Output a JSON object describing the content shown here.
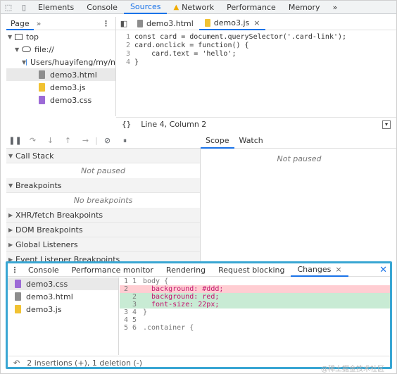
{
  "top_tabs": [
    "Elements",
    "Console",
    "Sources",
    "Network",
    "Performance",
    "Memory"
  ],
  "top_tab_active": "Sources",
  "top_more": "»",
  "navigator": {
    "tab": "Page",
    "chevron": "»",
    "more": "⋮",
    "tree": {
      "top": "top",
      "origin": "file://",
      "folder": "Users/huayifeng/my/n",
      "files": [
        "demo3.html",
        "demo3.js",
        "demo3.css"
      ]
    }
  },
  "editor": {
    "tabs": [
      {
        "label": "demo3.html",
        "active": false
      },
      {
        "label": "demo3.js",
        "active": true,
        "close": "×"
      }
    ],
    "lines": [
      {
        "n": "1",
        "code": "const card = document.querySelector('.card-link');"
      },
      {
        "n": "2",
        "code": "card.onclick = function() {"
      },
      {
        "n": "3",
        "code": "    card.text = 'hello';"
      },
      {
        "n": "4",
        "code": "}"
      }
    ],
    "status": {
      "braces": "{}",
      "position": "Line 4, Column 2"
    }
  },
  "debugger": {
    "sections": [
      {
        "label": "Call Stack",
        "expanded": true,
        "body": "Not paused"
      },
      {
        "label": "Breakpoints",
        "expanded": true,
        "body": "No breakpoints"
      },
      {
        "label": "XHR/fetch Breakpoints",
        "expanded": false
      },
      {
        "label": "DOM Breakpoints",
        "expanded": false
      },
      {
        "label": "Global Listeners",
        "expanded": false
      },
      {
        "label": "Event Listener Breakpoints",
        "expanded": false
      }
    ],
    "right_tabs": [
      "Scope",
      "Watch"
    ],
    "right_active": "Scope",
    "right_body": "Not paused"
  },
  "drawer": {
    "more": "⋮",
    "tabs": [
      "Console",
      "Performance monitor",
      "Rendering",
      "Request blocking",
      "Changes"
    ],
    "active": "Changes",
    "tab_close": "×",
    "drawer_close": "✕",
    "files": [
      "demo3.css",
      "demo3.html",
      "demo3.js"
    ],
    "selected_file": "demo3.css",
    "diff": [
      {
        "o": "1",
        "n": "1",
        "t": "body {",
        "kind": "ctx"
      },
      {
        "o": "2",
        "n": "",
        "t": "  background: #ddd;",
        "kind": "del"
      },
      {
        "o": "",
        "n": "2",
        "t": "  background: red;",
        "kind": "add"
      },
      {
        "o": "",
        "n": "3",
        "t": "  font-size: 22px;",
        "kind": "add"
      },
      {
        "o": "3",
        "n": "4",
        "t": "}",
        "kind": "ctx"
      },
      {
        "o": "4",
        "n": "5",
        "t": "",
        "kind": "ctx"
      },
      {
        "o": "5",
        "n": "6",
        "t": ".container {",
        "kind": "ctx"
      }
    ],
    "status": "2 insertions (+), 1 deletion (-)"
  },
  "watermark": "@稀土掘金技术社区"
}
